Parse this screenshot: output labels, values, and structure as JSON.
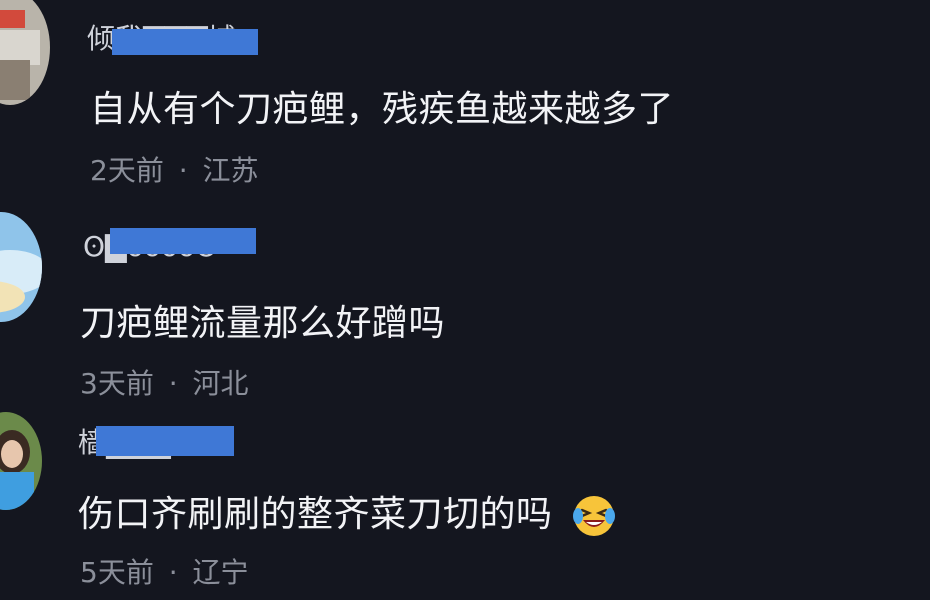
{
  "comments": [
    {
      "username": "倾我▇▇▇城",
      "text": "自从有个刀疤鲤，残疾鱼越来越多了",
      "time": "2天前",
      "separator": "·",
      "location": "江苏"
    },
    {
      "username": "ʘ▇ᴗᴗᴗᴗʘ",
      "text": "刀疤鲤流量那么好蹭吗",
      "time": "3天前",
      "separator": "·",
      "location": "河北"
    },
    {
      "username": "樯▇▇▇",
      "text": "伤口齐刷刷的整齐菜刀切的吗",
      "emoji": "laughing-crying-emoji",
      "time": "5天前",
      "separator": "·",
      "location": "辽宁"
    }
  ],
  "colors": {
    "background": "#14161f",
    "username": "#cfd2da",
    "text": "#f2f3f6",
    "meta": "#8b8f9a",
    "redaction": "#3f78d6"
  }
}
